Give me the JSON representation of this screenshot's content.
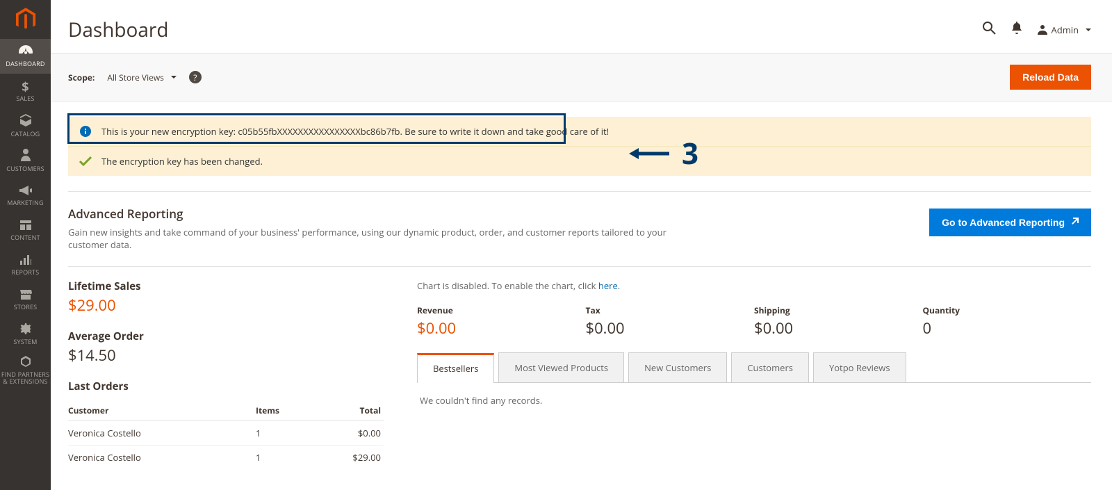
{
  "sidebar": {
    "items": [
      {
        "label": "DASHBOARD",
        "icon": "◷"
      },
      {
        "label": "SALES",
        "icon": "$"
      },
      {
        "label": "CATALOG",
        "icon": "⬓"
      },
      {
        "label": "CUSTOMERS",
        "icon": "👤"
      },
      {
        "label": "MARKETING",
        "icon": "📣"
      },
      {
        "label": "CONTENT",
        "icon": "▦"
      },
      {
        "label": "REPORTS",
        "icon": "▥"
      },
      {
        "label": "STORES",
        "icon": "🏬"
      },
      {
        "label": "SYSTEM",
        "icon": "⚙"
      },
      {
        "label": "FIND PARTNERS\n& EXTENSIONS",
        "icon": "◒"
      }
    ]
  },
  "header": {
    "page_title": "Dashboard",
    "admin_label": "Admin"
  },
  "toolbar": {
    "scope_label": "Scope:",
    "scope_value": "All Store Views",
    "reload_label": "Reload Data"
  },
  "messages": {
    "info": "This is your new encryption key: c05b55fbXXXXXXXXXXXXXXXXbc86b7fb. Be sure to write it down and take good care of it!",
    "success": "The encryption key has been changed."
  },
  "callout_number": "3",
  "advanced": {
    "title": "Advanced Reporting",
    "desc": "Gain new insights and take command of your business' performance, using our dynamic product, order, and customer reports tailored to your customer data.",
    "button": "Go to Advanced Reporting"
  },
  "stats": {
    "lifetime_label": "Lifetime Sales",
    "lifetime_value": "$29.00",
    "average_label": "Average Order",
    "average_value": "$14.50"
  },
  "last_orders": {
    "title": "Last Orders",
    "cols": {
      "customer": "Customer",
      "items": "Items",
      "total": "Total"
    },
    "rows": [
      {
        "customer": "Veronica Costello",
        "items": "1",
        "total": "$0.00"
      },
      {
        "customer": "Veronica Costello",
        "items": "1",
        "total": "$29.00"
      }
    ]
  },
  "chart_hint": {
    "prefix": "Chart is disabled. To enable the chart, click ",
    "link": "here",
    "suffix": "."
  },
  "metrics": {
    "revenue": {
      "label": "Revenue",
      "value": "$0.00"
    },
    "tax": {
      "label": "Tax",
      "value": "$0.00"
    },
    "shipping": {
      "label": "Shipping",
      "value": "$0.00"
    },
    "quantity": {
      "label": "Quantity",
      "value": "0"
    }
  },
  "tabs": {
    "items": [
      {
        "label": "Bestsellers"
      },
      {
        "label": "Most Viewed Products"
      },
      {
        "label": "New Customers"
      },
      {
        "label": "Customers"
      },
      {
        "label": "Yotpo Reviews"
      }
    ],
    "empty": "We couldn't find any records."
  }
}
